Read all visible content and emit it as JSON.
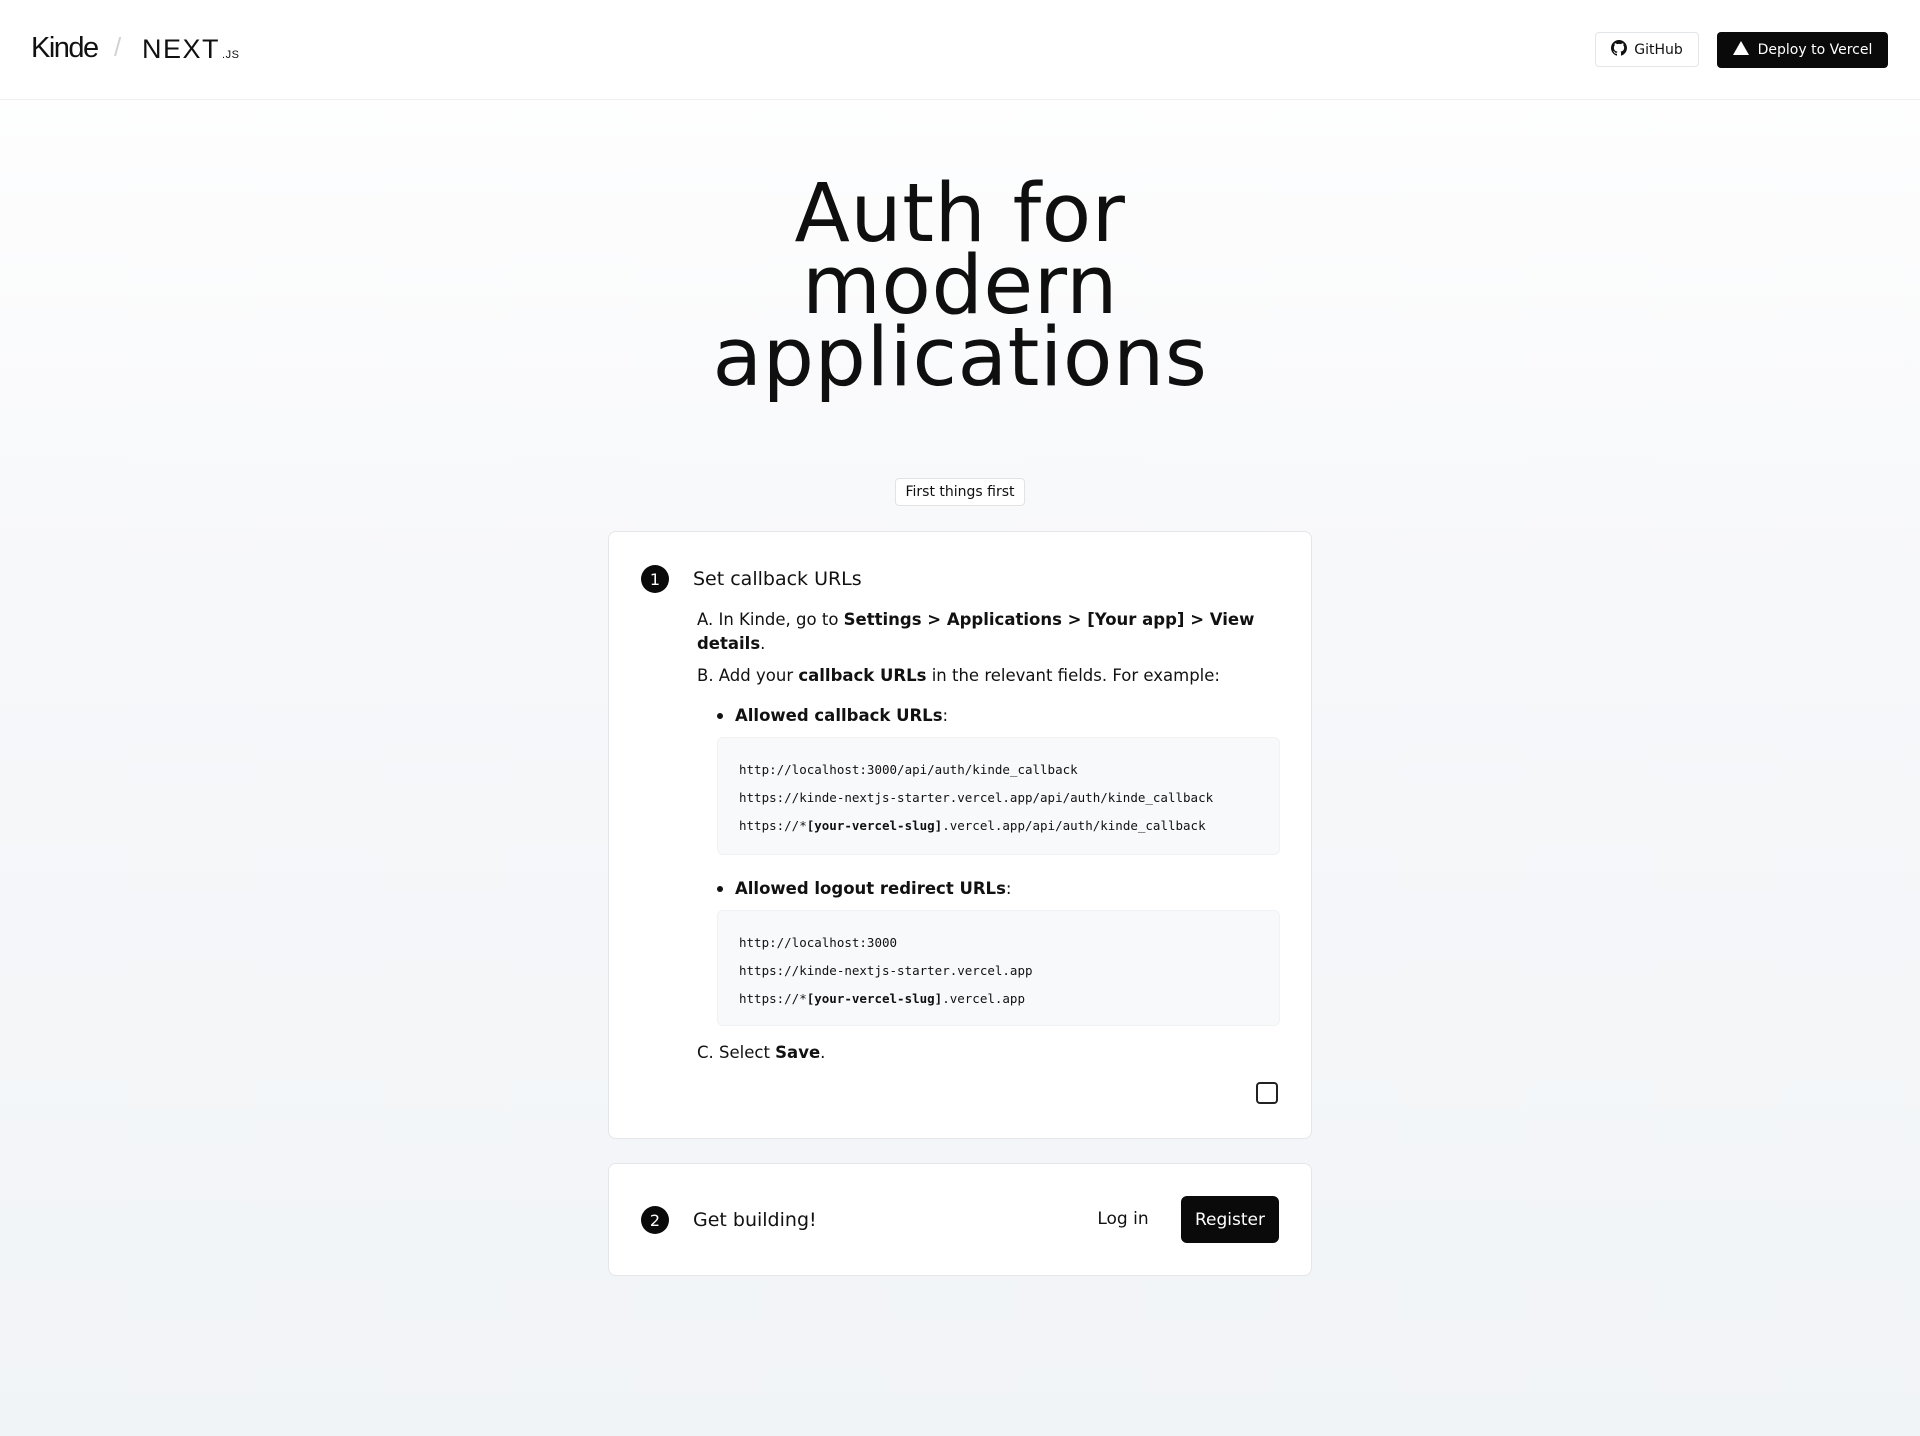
{
  "header": {
    "brand_kinde": "Kinde",
    "brand_separator": "/",
    "brand_next": "NEXT",
    "brand_next_sub": ".JS",
    "github_label": "GitHub",
    "deploy_label": "Deploy to Vercel"
  },
  "hero": {
    "line1": "Auth for",
    "line2": "modern",
    "line3": "applications"
  },
  "pill": "First things first",
  "step1": {
    "number": "1",
    "title": "Set callback URLs",
    "a_prefix": "A. In Kinde, go to ",
    "a_bold": "Settings > Applications > [Your app] > View details",
    "a_suffix": ".",
    "b_prefix": "B. Add your ",
    "b_bold": "callback URLs",
    "b_suffix": " in the relevant fields. For example:",
    "callback_heading": "Allowed callback URLs",
    "logout_heading": "Allowed logout redirect URLs",
    "colon": ":",
    "callback_urls": {
      "line1": "http://localhost:3000/api/auth/kinde_callback",
      "line2": "https://kinde-nextjs-starter.vercel.app/api/auth/kinde_callback",
      "line3_pre": "https://*",
      "line3_slug": "[your-vercel-slug]",
      "line3_post": ".vercel.app/api/auth/kinde_callback"
    },
    "logout_urls": {
      "line1": "http://localhost:3000",
      "line2": "https://kinde-nextjs-starter.vercel.app",
      "line3_pre": "https://*",
      "line3_slug": "[your-vercel-slug]",
      "line3_post": ".vercel.app"
    },
    "c_prefix": "C. Select ",
    "c_bold": "Save",
    "c_suffix": "."
  },
  "step2": {
    "number": "2",
    "title": "Get building!",
    "login_label": "Log in",
    "register_label": "Register"
  }
}
